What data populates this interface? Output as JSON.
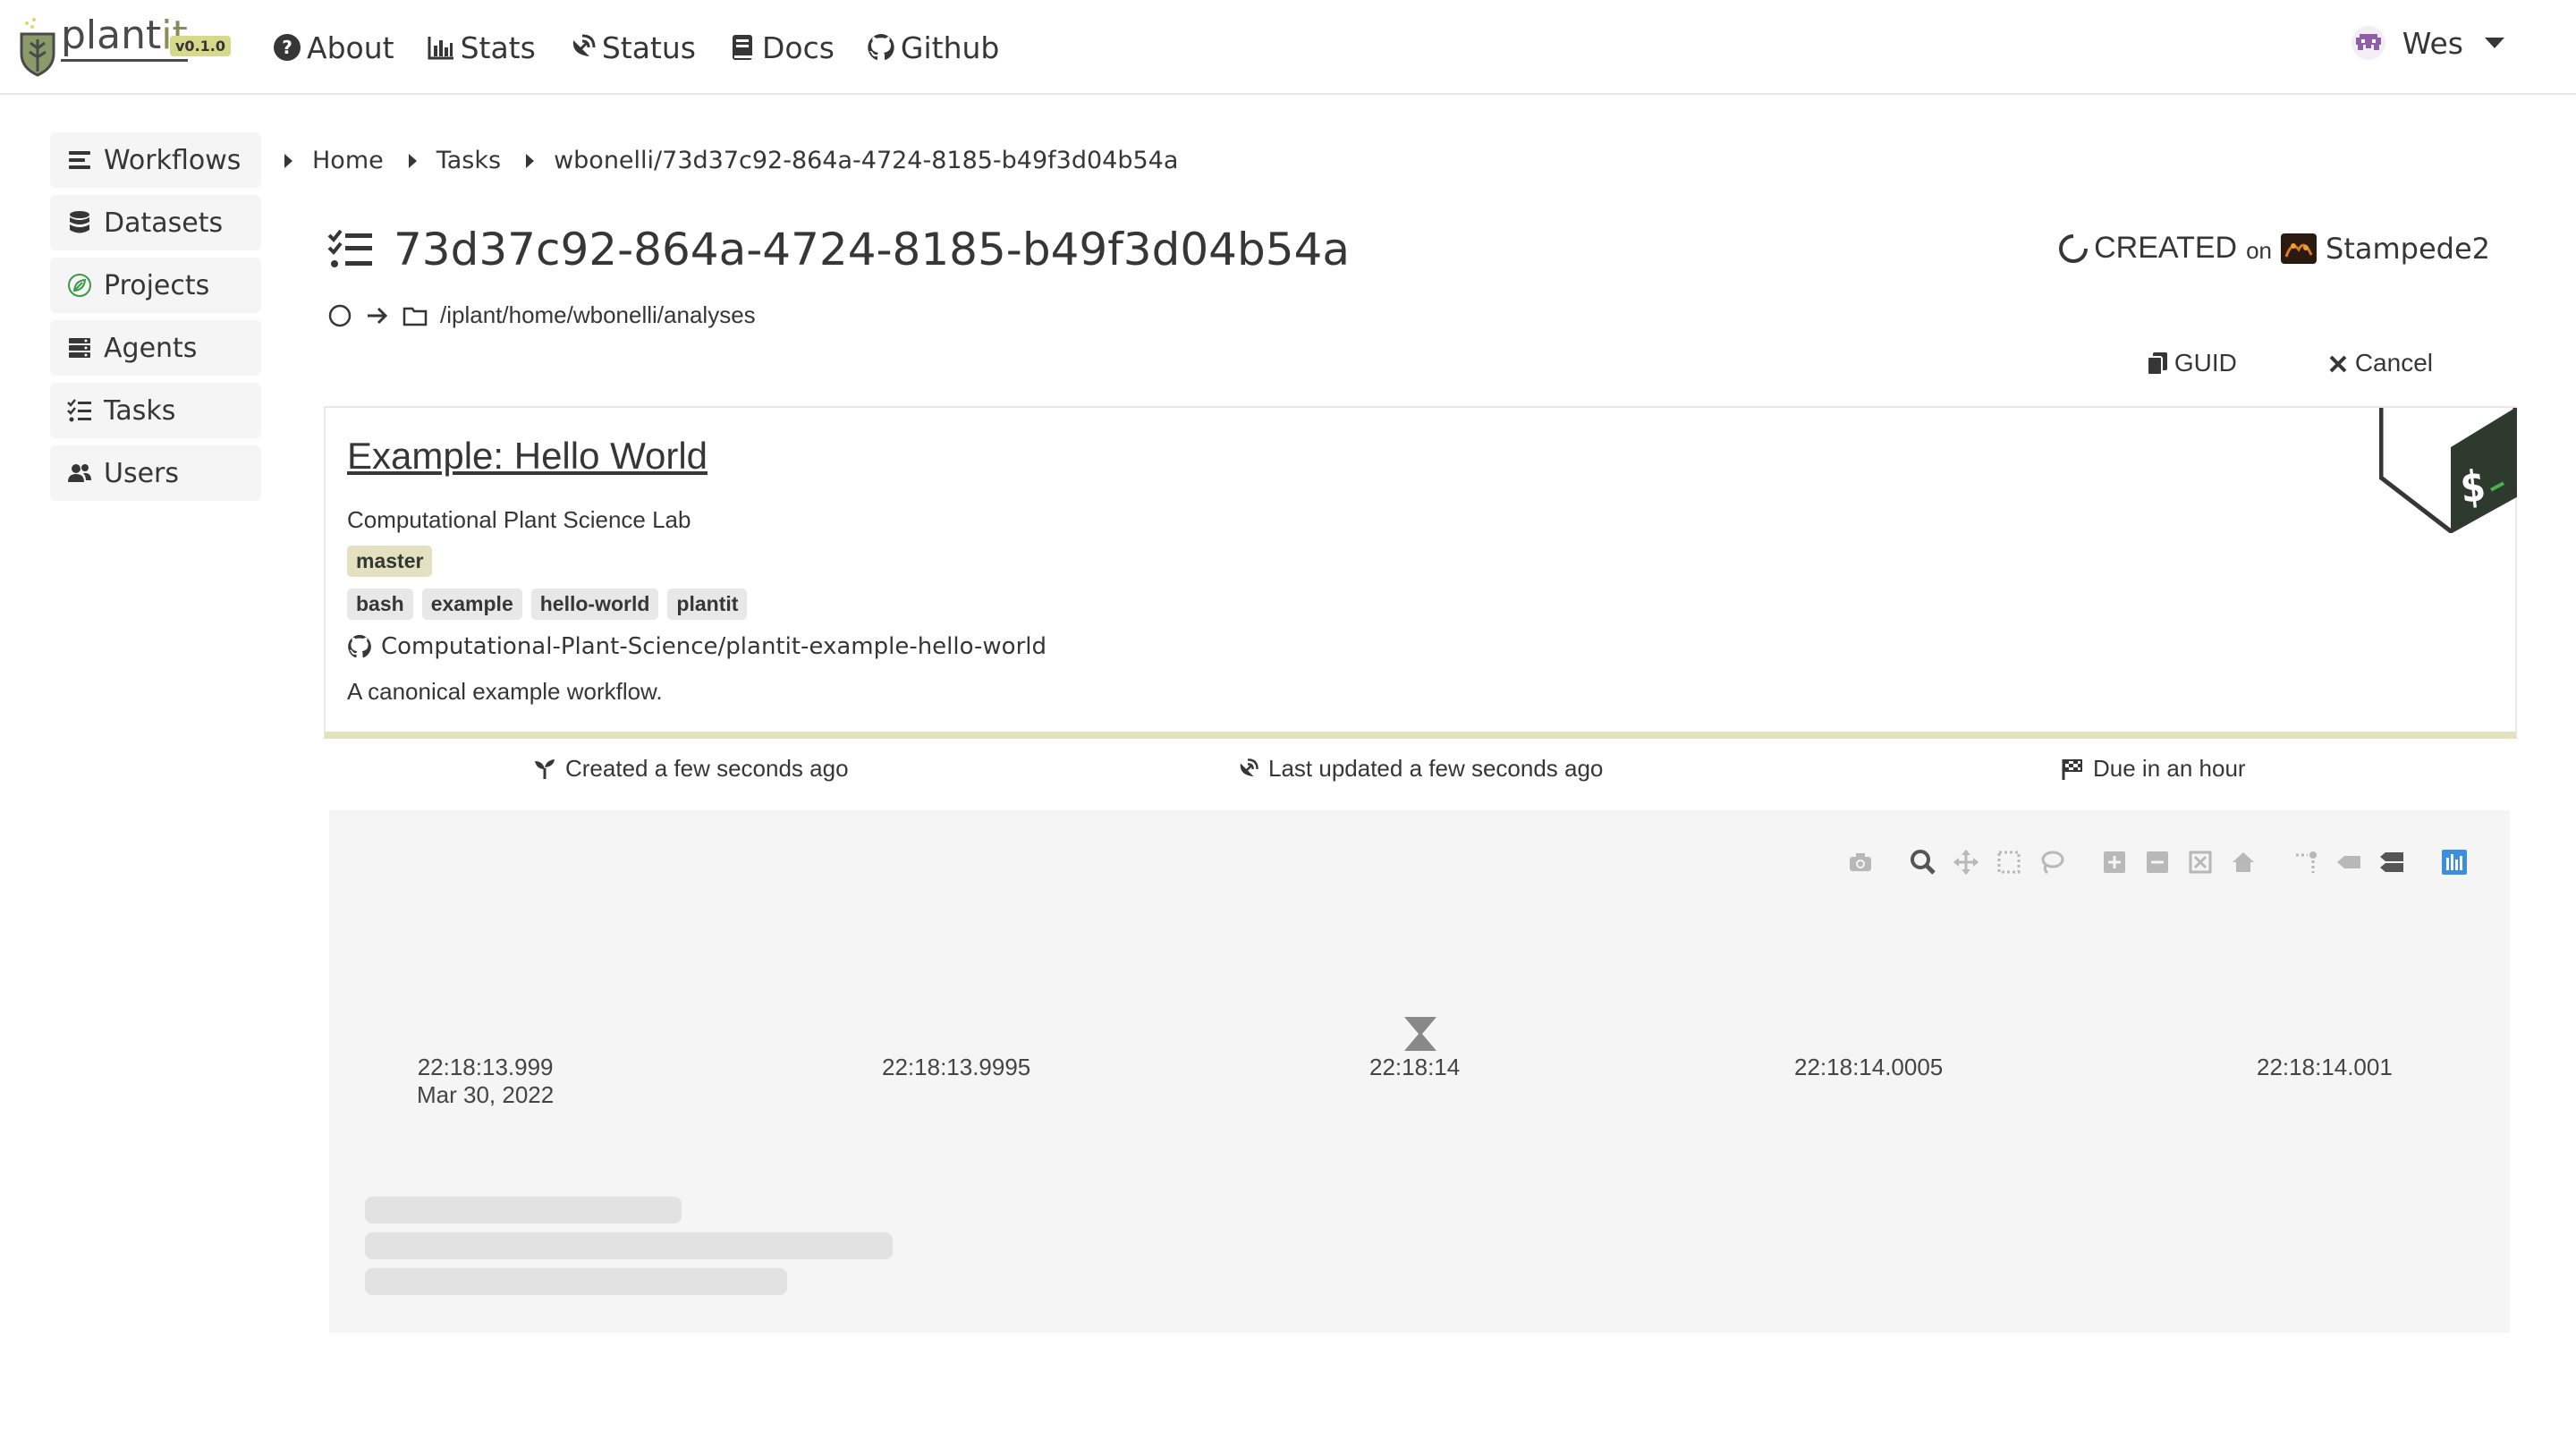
{
  "brand": {
    "name": "plant",
    "suffix": "it",
    "version": "v0.1.0"
  },
  "nav": {
    "items": [
      {
        "label": "About",
        "icon": "question-circle-icon"
      },
      {
        "label": "Stats",
        "icon": "bar-chart-icon"
      },
      {
        "label": "Status",
        "icon": "satellite-dish-icon"
      },
      {
        "label": "Docs",
        "icon": "book-icon"
      },
      {
        "label": "Github",
        "icon": "github-icon"
      }
    ],
    "user": {
      "name": "Wes",
      "avatar": "pixel-invader-avatar"
    }
  },
  "sidebar": {
    "items": [
      {
        "label": "Workflows",
        "icon": "list-icon"
      },
      {
        "label": "Datasets",
        "icon": "database-icon"
      },
      {
        "label": "Projects",
        "icon": "leaf-circle-icon"
      },
      {
        "label": "Agents",
        "icon": "server-icon"
      },
      {
        "label": "Tasks",
        "icon": "tasks-icon"
      },
      {
        "label": "Users",
        "icon": "users-icon"
      }
    ]
  },
  "breadcrumb": {
    "items": [
      "Home",
      "Tasks",
      "wbonelli/73d37c92-864a-4724-8185-b49f3d04b54a"
    ]
  },
  "task": {
    "guid": "73d37c92-864a-4724-8185-b49f3d04b54a",
    "status": "CREATED",
    "on_label": "on",
    "agent": "Stampede2",
    "path": "/iplant/home/wbonelli/analyses",
    "actions": {
      "guid_label": "GUID",
      "cancel_label": "Cancel"
    }
  },
  "workflow": {
    "name": "Example: Hello World",
    "organization": "Computational Plant Science Lab",
    "branch": "master",
    "topics": [
      "bash",
      "example",
      "hello-world",
      "plantit"
    ],
    "repo": "Computational-Plant-Science/plantit-example-hello-world",
    "description": "A canonical example workflow.",
    "accent_color": "#e3e1bf"
  },
  "timestamps": {
    "created": "Created a few seconds ago",
    "updated": "Last updated a few seconds ago",
    "due": "Due in an hour"
  },
  "chart_data": {
    "type": "scatter",
    "title": "",
    "xlabel": "",
    "ylabel": "",
    "x_ticks": [
      {
        "time": "22:18:13.999",
        "date": "Mar 30, 2022"
      },
      {
        "time": "22:18:13.9995",
        "date": ""
      },
      {
        "time": "22:18:14",
        "date": ""
      },
      {
        "time": "22:18:14.0005",
        "date": ""
      },
      {
        "time": "22:18:14.001",
        "date": ""
      }
    ],
    "series": [],
    "modebar": [
      "camera-icon",
      "zoom-icon",
      "pan-icon",
      "box-select-icon",
      "lasso-icon",
      "zoom-in-icon",
      "zoom-out-icon",
      "autoscale-icon",
      "reset-axes-icon",
      "spike-lines-icon",
      "hover-closest-icon",
      "hover-compare-icon",
      "plotly-logo-icon"
    ]
  }
}
